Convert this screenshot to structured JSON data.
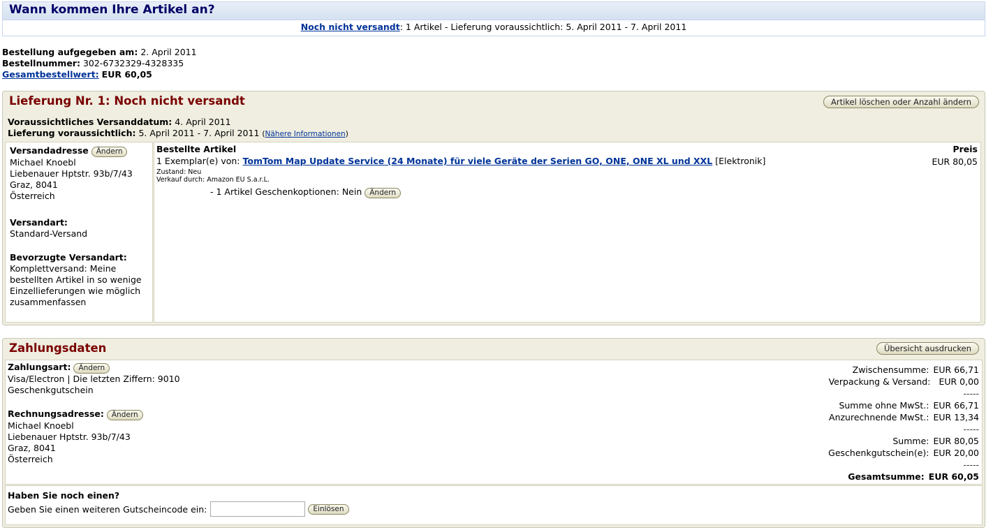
{
  "header": {
    "title": "Wann kommen Ihre Artikel an?",
    "status_link": "Noch nicht versandt",
    "status_text": ": 1 Artikel - Lieferung voraussichtlich: 5. April 2011 - 7. April 2011"
  },
  "order": {
    "placed_label": "Bestellung aufgegeben am:",
    "placed_value": "2. April 2011",
    "number_label": "Bestellnummer:",
    "number_value": "302-6732329-4328335",
    "total_link": "Gesamtbestellwert:",
    "total_value": "EUR 60,05"
  },
  "delivery": {
    "title": "Lieferung Nr. 1: Noch nicht versandt",
    "change_button": "Artikel löschen oder Anzahl ändern",
    "ship_date_label": "Voraussichtliches Versanddatum:",
    "ship_date_value": "4. April 2011",
    "eta_label": "Lieferung voraussichtlich:",
    "eta_value": "5. April 2011 - 7. April 2011",
    "more_info_open": "(",
    "more_info": "Nähere Informationen",
    "more_info_close": ")",
    "address_label": "Versandadresse",
    "change_label": "Ändern",
    "address_lines": [
      "Michael Knoebl",
      "Liebenauer Hptstr. 93b/7/43",
      "Graz, 8041",
      "Österreich"
    ],
    "ship_method_label": "Versandart:",
    "ship_method_value": "Standard-Versand",
    "pref_label": "Bevorzugte Versandart:",
    "pref_lines": [
      "Komplettversand: Meine",
      "bestellten Artikel in so wenige",
      "Einzellieferungen wie möglich",
      "zusammenfassen"
    ],
    "items_header": "Bestellte Artikel",
    "price_header": "Preis",
    "item_qty": "1 Exemplar(e) von:",
    "item_title": "TomTom Map Update Service (24 Monate) für viele Geräte der Serien GO, ONE, ONE XL und XXL",
    "item_category": "[Elektronik]",
    "item_price": "EUR 80,05",
    "item_condition": "Zustand: Neu",
    "item_seller": "Verkauf durch: Amazon EU S.a.r.L.",
    "gift_options": "- 1 Artikel Geschenkoptionen: Nein"
  },
  "payment": {
    "title": "Zahlungsdaten",
    "print_button": "Übersicht ausdrucken",
    "method_label": "Zahlungsart:",
    "change_label": "Ändern",
    "method_lines": [
      "Visa/Electron | Die letzten Ziffern: 9010",
      "Geschenkgutschein"
    ],
    "billing_label": "Rechnungsadresse:",
    "billing_lines": [
      "Michael Knoebl",
      "Liebenauer Hptstr. 93b/7/43",
      "Graz, 8041",
      "Österreich"
    ],
    "totals": {
      "subtotal_label": "Zwischensumme:",
      "subtotal_value": "EUR 66,71",
      "shipping_label": "Verpackung & Versand:",
      "shipping_value": "EUR 0,00",
      "separator": "-----",
      "net_label": "Summe ohne MwSt.:",
      "net_value": "EUR 66,71",
      "vat_label": "Anzurechnende MwSt.:",
      "vat_value": "EUR 13,34",
      "sum_label": "Summe:",
      "sum_value": "EUR 80,05",
      "voucher_label": "Geschenkgutschein(e):",
      "voucher_value": "EUR 20,00",
      "grand_label": "Gesamtsumme:",
      "grand_value": "EUR 60,05"
    },
    "voucher_question": "Haben Sie noch einen?",
    "voucher_prompt": "Geben Sie einen weiteren Gutscheincode ein:",
    "voucher_input": "",
    "redeem_button": "Einlösen"
  }
}
